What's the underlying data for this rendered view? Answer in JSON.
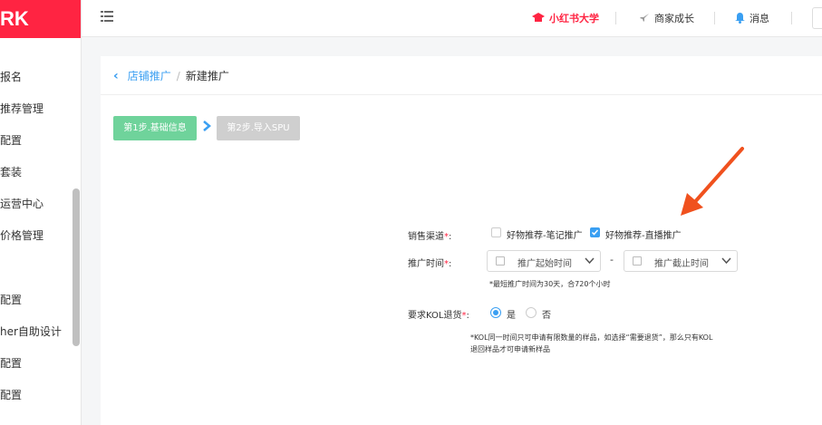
{
  "brand": {
    "text": "RK"
  },
  "sidebar": {
    "items": [
      {
        "label": "报名"
      },
      {
        "label": "推荐管理"
      },
      {
        "label": "配置"
      },
      {
        "label": "套装"
      },
      {
        "label": "运营中心"
      },
      {
        "label": "价格管理"
      },
      {
        "label": "配置"
      },
      {
        "label": "her自助设计"
      },
      {
        "label": "配置"
      },
      {
        "label": "配置"
      }
    ]
  },
  "header": {
    "university": "小红书大学",
    "growth": "商家成长",
    "messages": "消息"
  },
  "breadcrumb": {
    "parent": "店铺推广",
    "separator": "/",
    "current": "新建推广"
  },
  "steps": {
    "step1": "第1步.基础信息",
    "step2": "第2步.导入SPU"
  },
  "form": {
    "channel": {
      "label": "销售渠道",
      "required_mark": "*",
      "colon": ":",
      "options": [
        {
          "label": "好物推荐-笔记推广",
          "checked": false
        },
        {
          "label": "好物推荐-直播推广",
          "checked": true
        }
      ]
    },
    "time": {
      "label": "推广时间",
      "required_mark": "*",
      "colon": ":",
      "start_placeholder": "推广起始时间",
      "end_placeholder": "推广截止时间",
      "range_sep": "-",
      "hint": "*最短推广时间为30天，合720个小时"
    },
    "kol_return": {
      "label": "要求KOL退货",
      "required_mark": "*",
      "colon": ":",
      "options": [
        {
          "label": "是",
          "selected": true
        },
        {
          "label": "否",
          "selected": false
        }
      ],
      "hint_line1": "*KOL同一时间只可申请有限数量的样品，如选择“需要退货”，那么只有KOL",
      "hint_line2": "退回样品才可申请新样品"
    }
  },
  "colors": {
    "brand_red": "#ff2442",
    "link_blue": "#3a9ff2",
    "step_active": "#6fd39b",
    "step_inactive": "#cfcfcf",
    "annotation_arrow": "#f0511e"
  }
}
